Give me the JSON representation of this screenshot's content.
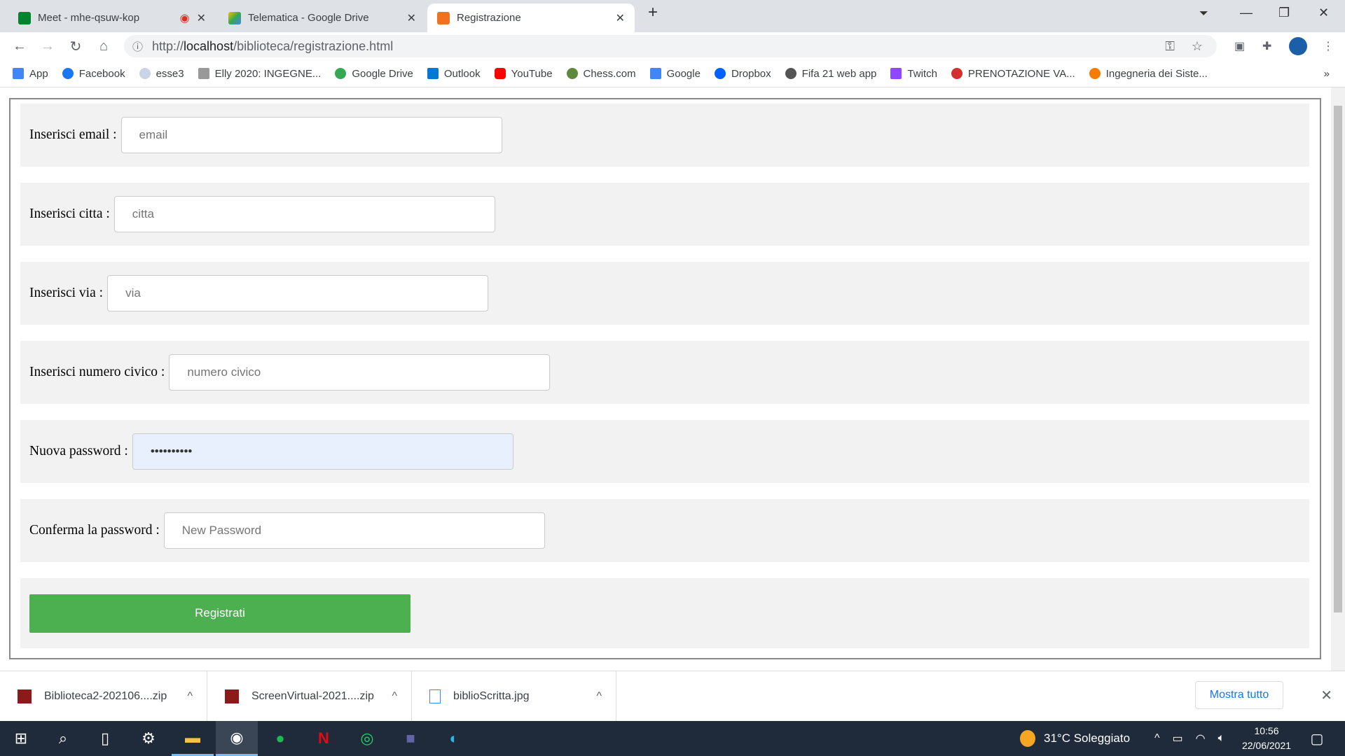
{
  "browser": {
    "tabs": [
      {
        "title": "Meet - mhe-qsuw-kop",
        "recording": true
      },
      {
        "title": "Telematica - Google Drive"
      },
      {
        "title": "Registrazione",
        "active": true
      }
    ],
    "url_prefix": "http://",
    "url_host": "localhost",
    "url_path": "/biblioteca/registrazione.html",
    "bookmarks": [
      "App",
      "Facebook",
      "esse3",
      "Elly 2020: INGEGNE...",
      "Google Drive",
      "Outlook",
      "YouTube",
      "Chess.com",
      "Google",
      "Dropbox",
      "Fifa 21 web app",
      "Twitch",
      "PRENOTAZIONE VA...",
      "Ingegneria dei Siste..."
    ],
    "more_bookmarks": "»"
  },
  "form": {
    "fields": [
      {
        "label": "Inserisci email :",
        "placeholder": "email",
        "value": ""
      },
      {
        "label": "Inserisci citta :",
        "placeholder": "citta",
        "value": ""
      },
      {
        "label": "Inserisci via :",
        "placeholder": "via",
        "value": ""
      },
      {
        "label": "Inserisci numero civico :",
        "placeholder": "numero civico",
        "value": ""
      },
      {
        "label": "Nuova password :",
        "placeholder": "",
        "value": "••••••••••"
      },
      {
        "label": "Conferma la password :",
        "placeholder": "New Password",
        "value": ""
      }
    ],
    "submit": "Registrati"
  },
  "downloads": {
    "items": [
      "Biblioteca2-202106....zip",
      "ScreenVirtual-2021....zip",
      "biblioScritta.jpg"
    ],
    "show_all": "Mostra tutto"
  },
  "taskbar": {
    "weather": "31°C  Soleggiato",
    "time": "10:56",
    "date": "22/06/2021"
  }
}
